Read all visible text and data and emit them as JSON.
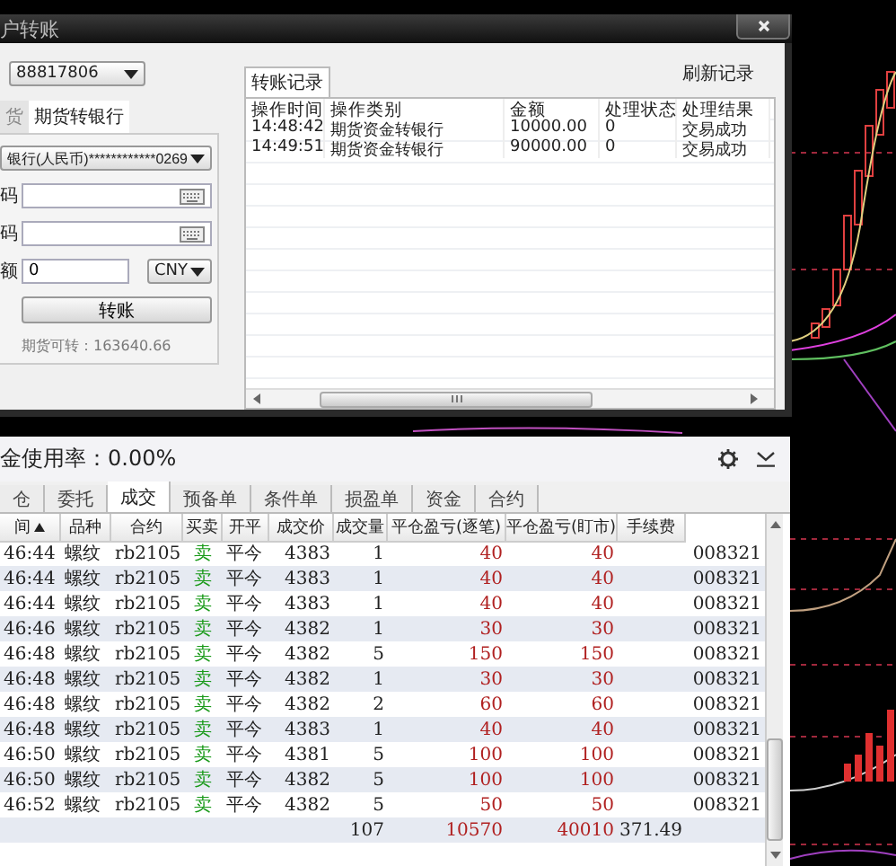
{
  "dialog": {
    "title": "户转账",
    "account": "88817806",
    "tabs": [
      {
        "label": "货",
        "selected": false
      },
      {
        "label": "期货转银行",
        "selected": true
      }
    ],
    "bank_account": "银行(人民币)************0269",
    "fields": [
      {
        "kind": "password",
        "label": "码"
      },
      {
        "kind": "password",
        "label": "码"
      },
      {
        "kind": "amount",
        "label": "额",
        "value": "0",
        "currency": "CNY"
      }
    ],
    "submit": "转账",
    "available": "期货可转：163640.66",
    "records": {
      "tab": "转账记录",
      "refresh": "刷新记录",
      "columns": [
        "操作时间",
        "操作类别",
        "金额",
        "处理状态",
        "处理结果"
      ],
      "rows": [
        [
          "14:48:42",
          "期货资金转银行",
          "10000.00",
          "0",
          "交易成功"
        ],
        [
          "14:49:51",
          "期货资金转银行",
          "90000.00",
          "0",
          "交易成功"
        ]
      ]
    }
  },
  "panel": {
    "title": "金使用率：0.00%",
    "tabs": [
      {
        "label": "仓",
        "selected": false
      },
      {
        "label": "委托",
        "selected": false
      },
      {
        "label": "成交",
        "selected": true
      },
      {
        "label": "预备单",
        "selected": false
      },
      {
        "label": "条件单",
        "selected": false
      },
      {
        "label": "损盈单",
        "selected": false
      },
      {
        "label": "资金",
        "selected": false
      },
      {
        "label": "合约",
        "selected": false
      }
    ],
    "columns": [
      {
        "label": "间",
        "sorted": true
      },
      {
        "label": "品种",
        "sorted": false
      },
      {
        "label": "合约",
        "sorted": false
      },
      {
        "label": "买卖",
        "sorted": false
      },
      {
        "label": "开平",
        "sorted": false
      },
      {
        "label": "成交价",
        "sorted": false
      },
      {
        "label": "成交量",
        "sorted": false
      },
      {
        "label": "平仓盈亏(逐笔)",
        "sorted": false
      },
      {
        "label": "平仓盈亏(盯市)",
        "sorted": false
      },
      {
        "label": "手续费",
        "sorted": false
      }
    ],
    "rows": [
      [
        "46:44",
        "螺纹",
        "rb2105",
        "卖",
        "平今",
        "4383",
        "1",
        "40",
        "40",
        "",
        "008321"
      ],
      [
        "46:44",
        "螺纹",
        "rb2105",
        "卖",
        "平今",
        "4383",
        "1",
        "40",
        "40",
        "",
        "008321"
      ],
      [
        "46:44",
        "螺纹",
        "rb2105",
        "卖",
        "平今",
        "4383",
        "1",
        "40",
        "40",
        "",
        "008321"
      ],
      [
        "46:46",
        "螺纹",
        "rb2105",
        "卖",
        "平今",
        "4382",
        "1",
        "30",
        "30",
        "",
        "008321"
      ],
      [
        "46:48",
        "螺纹",
        "rb2105",
        "卖",
        "平今",
        "4382",
        "5",
        "150",
        "150",
        "",
        "008321"
      ],
      [
        "46:48",
        "螺纹",
        "rb2105",
        "卖",
        "平今",
        "4382",
        "1",
        "30",
        "30",
        "",
        "008321"
      ],
      [
        "46:48",
        "螺纹",
        "rb2105",
        "卖",
        "平今",
        "4382",
        "2",
        "60",
        "60",
        "",
        "008321"
      ],
      [
        "46:48",
        "螺纹",
        "rb2105",
        "卖",
        "平今",
        "4383",
        "1",
        "40",
        "40",
        "",
        "008321"
      ],
      [
        "46:50",
        "螺纹",
        "rb2105",
        "卖",
        "平今",
        "4381",
        "5",
        "100",
        "100",
        "",
        "008321"
      ],
      [
        "46:50",
        "螺纹",
        "rb2105",
        "卖",
        "平今",
        "4382",
        "5",
        "100",
        "100",
        "",
        "008321"
      ],
      [
        "46:52",
        "螺纹",
        "rb2105",
        "卖",
        "平今",
        "4382",
        "5",
        "50",
        "50",
        "",
        "008321"
      ]
    ],
    "total": {
      "qty": "107",
      "pnl_trade": "10570",
      "pnl_mark": "40010",
      "fee": "371.49"
    }
  }
}
